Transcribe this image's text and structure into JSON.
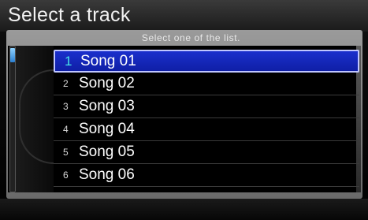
{
  "header": {
    "title": "Select a track"
  },
  "subtitle": "Select one of the list.",
  "tracks": [
    {
      "number": "1",
      "name": "Song 01"
    },
    {
      "number": "2",
      "name": "Song 02"
    },
    {
      "number": "3",
      "name": "Song 03"
    },
    {
      "number": "4",
      "name": "Song 04"
    },
    {
      "number": "5",
      "name": "Song 05"
    },
    {
      "number": "6",
      "name": "Song 06"
    }
  ],
  "selected_index": 0,
  "colors": {
    "selection": "#1a2fcc",
    "selected_number": "#48e2e6"
  }
}
